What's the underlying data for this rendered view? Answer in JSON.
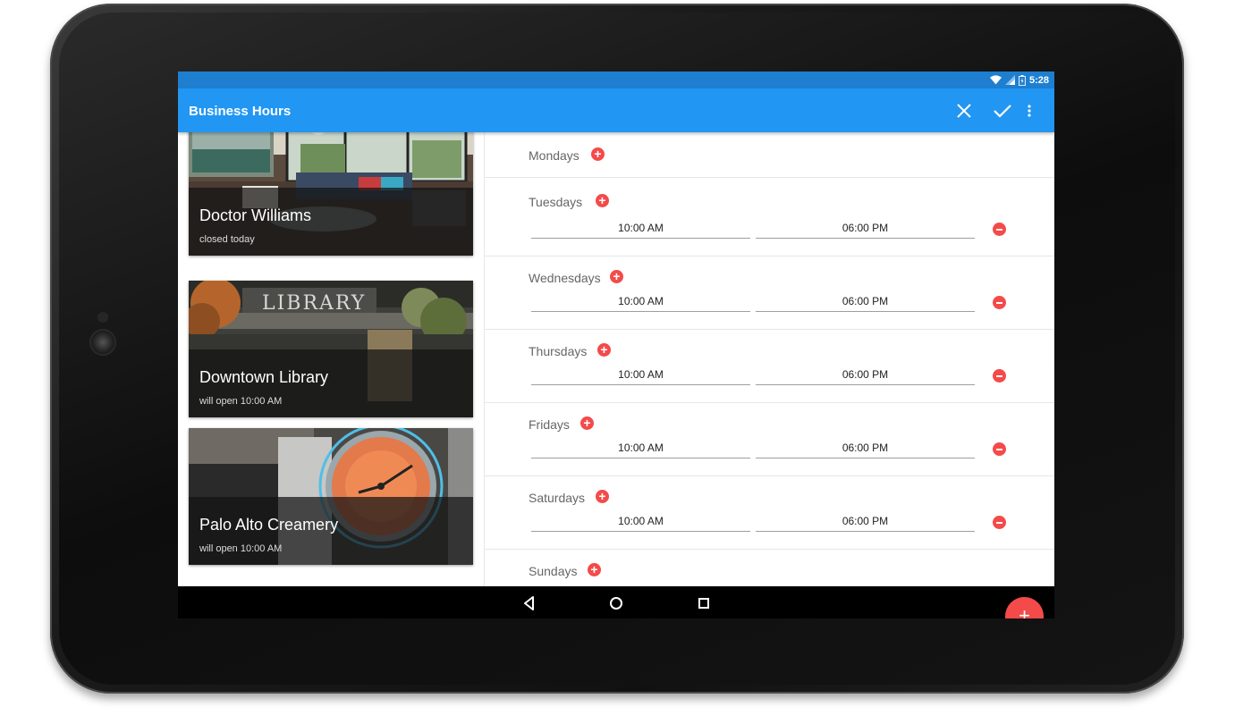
{
  "status_bar": {
    "time": "5:28",
    "icons": [
      "wifi-icon",
      "signal-icon",
      "battery-icon"
    ]
  },
  "app_bar": {
    "title": "Business Hours",
    "actions": [
      {
        "name": "close",
        "icon": "close-icon"
      },
      {
        "name": "confirm",
        "icon": "check-icon"
      },
      {
        "name": "overflow",
        "icon": "more-vert-icon"
      }
    ]
  },
  "places": [
    {
      "name": "Doctor Williams",
      "status": "closed today"
    },
    {
      "name": "Downtown Library",
      "status": "will open 10:00 AM"
    },
    {
      "name": "Palo Alto Creamery",
      "status": "will open 10:00 AM"
    }
  ],
  "days": [
    {
      "label": "Mondays",
      "slots": []
    },
    {
      "label": "Tuesdays",
      "slots": [
        {
          "open": "10:00 AM",
          "close": "06:00 PM"
        }
      ]
    },
    {
      "label": "Wednesdays",
      "slots": [
        {
          "open": "10:00 AM",
          "close": "06:00 PM"
        }
      ]
    },
    {
      "label": "Thursdays",
      "slots": [
        {
          "open": "10:00 AM",
          "close": "06:00 PM"
        }
      ]
    },
    {
      "label": "Fridays",
      "slots": [
        {
          "open": "10:00 AM",
          "close": "06:00 PM"
        }
      ]
    },
    {
      "label": "Saturdays",
      "slots": [
        {
          "open": "10:00 AM",
          "close": "06:00 PM"
        }
      ]
    },
    {
      "label": "Sundays",
      "slots": []
    }
  ],
  "fab": {
    "label": "+"
  },
  "colors": {
    "primary": "#2196f3",
    "primary_dark": "#1e7fd0",
    "accent": "#f44a4a"
  }
}
